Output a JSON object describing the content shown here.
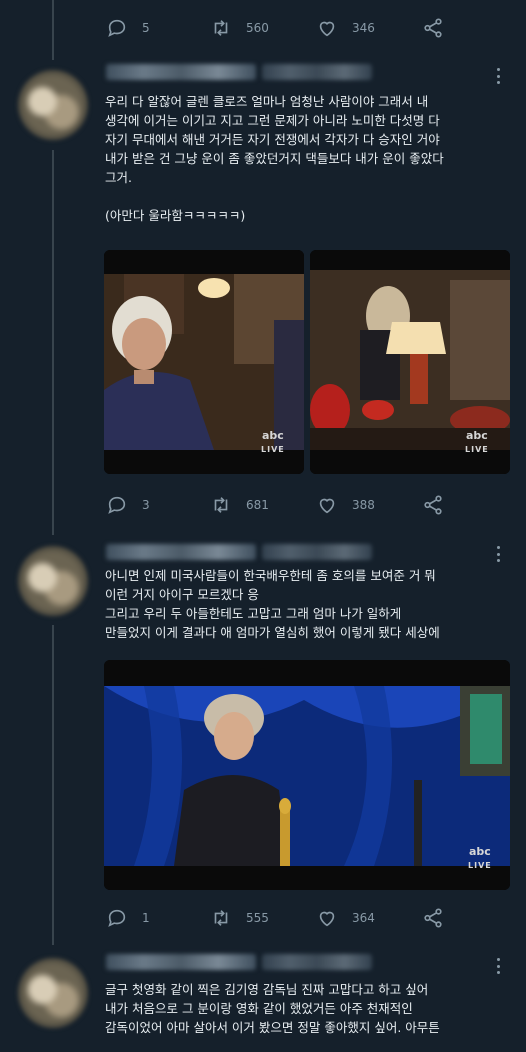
{
  "tweets": [
    {
      "actions": {
        "reply_count": "5",
        "retweet_count": "560",
        "like_count": "346"
      }
    },
    {
      "text": "우리 다 알잖어 글렌 클로즈 얼마나 엄청난 사람이야 그래서 내\n생각에 이거는 이기고 지고 그런 문제가 아니라 노미한 다섯명 다\n자기 무대에서 해낸 거거든 자기 전쟁에서 각자가 다 승자인 거야\n내가 받은 건 그냥 운이 좀 좋았던거지 댁들보다 내가 운이 좋았다\n그거.\n\n(아만다 울라함ㅋㅋㅋㅋㅋ)",
      "media": [
        {
          "logo": "abc",
          "live": "LIVE"
        },
        {
          "logo": "abc",
          "live": "LIVE"
        }
      ],
      "actions": {
        "reply_count": "3",
        "retweet_count": "681",
        "like_count": "388"
      }
    },
    {
      "text": "아니면 인제 미국사람들이 한국배우한테 좀 호의를 보여준 거 뭐\n이런 거지 아이구 모르겠다 응\n그리고 우리 두 아들한테도 고맙고 그래 엄마 나가 일하게\n만들었지 이게 결과다 애 엄마가 열심히 했어 이렇게 됐다 세상에",
      "media": [
        {
          "logo": "abc",
          "live": "LIVE"
        }
      ],
      "actions": {
        "reply_count": "1",
        "retweet_count": "555",
        "like_count": "364"
      }
    },
    {
      "text": "글구 첫영화 같이 찍은 김기영 감독님 진짜 고맙다고 하고 싶어\n내가 처음으로 그 분이랑 영화 같이 했었거든 아주 천재적인\n감독이었어 아마 살아서 이거 봤으면 정말 좋아했지 싶어. 아무튼"
    }
  ],
  "colors": {
    "background": "#15202b",
    "text": "#e1e8ed",
    "muted": "#8899a6",
    "thread": "#38444d"
  }
}
